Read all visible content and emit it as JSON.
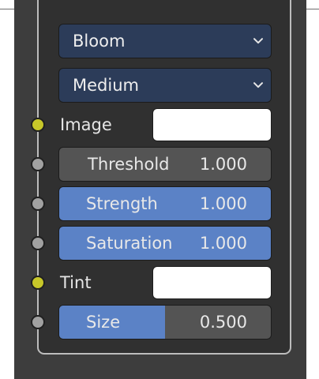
{
  "node": {
    "type_dropdown": {
      "label": "Bloom"
    },
    "quality_dropdown": {
      "label": "Medium"
    },
    "rows": [
      {
        "label": "Image",
        "socket": "yellow"
      },
      {
        "label": "Threshold",
        "value": "1.000",
        "socket": "gray"
      },
      {
        "label": "Strength",
        "value": "1.000",
        "socket": "gray"
      },
      {
        "label": "Saturation",
        "value": "1.000",
        "socket": "gray"
      },
      {
        "label": "Tint",
        "socket": "yellow"
      },
      {
        "label": "Size",
        "value": "0.500",
        "fill_fraction": 0.5,
        "socket": "gray"
      }
    ]
  },
  "colors": {
    "dropdown_bg": "#2c3c59",
    "field_blue": "#5b82c6",
    "field_dark": "#545454",
    "socket_yellow": "#c7c729",
    "socket_gray": "#a1a1a1",
    "swatch": "#ffffff"
  },
  "icons": {
    "dropdown_arrow": "chevron-down-icon"
  }
}
